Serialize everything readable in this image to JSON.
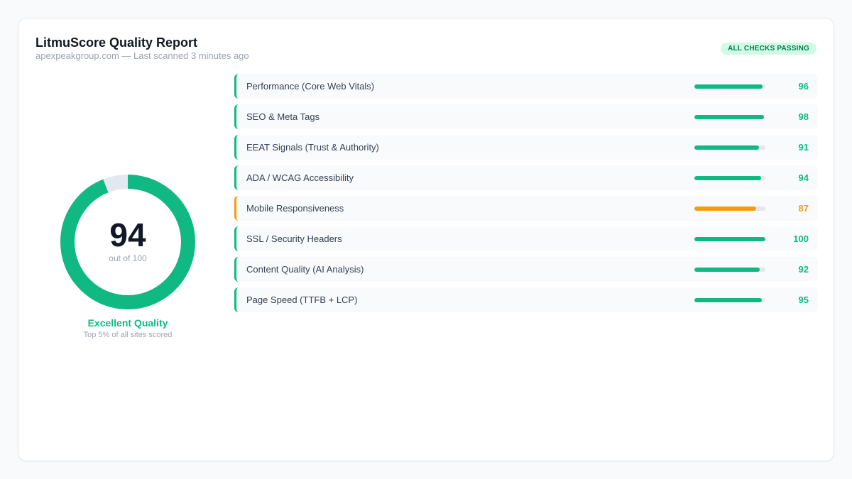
{
  "header": {
    "title": "LitmuScore Quality Report",
    "subtitle": "apexpeakgroup.com — Last scanned 3 minutes ago",
    "badge": "ALL CHECKS PASSING"
  },
  "score": {
    "value": 94,
    "value_text": "94",
    "max": 100,
    "out_of": "out of 100",
    "quality": "Excellent Quality",
    "quality_sub": "Top 5% of all sites scored"
  },
  "colors": {
    "good": "#10b981",
    "warn": "#f59e0b",
    "track": "#e2e8f0"
  },
  "metrics": [
    {
      "label": "Performance (Core Web Vitals)",
      "value": 96,
      "status": "good"
    },
    {
      "label": "SEO & Meta Tags",
      "value": 98,
      "status": "good"
    },
    {
      "label": "EEAT Signals (Trust & Authority)",
      "value": 91,
      "status": "good"
    },
    {
      "label": "ADA / WCAG Accessibility",
      "value": 94,
      "status": "good"
    },
    {
      "label": "Mobile Responsiveness",
      "value": 87,
      "status": "warn"
    },
    {
      "label": "SSL / Security Headers",
      "value": 100,
      "status": "good"
    },
    {
      "label": "Content Quality (AI Analysis)",
      "value": 92,
      "status": "good"
    },
    {
      "label": "Page Speed (TTFB + LCP)",
      "value": 95,
      "status": "good"
    }
  ]
}
